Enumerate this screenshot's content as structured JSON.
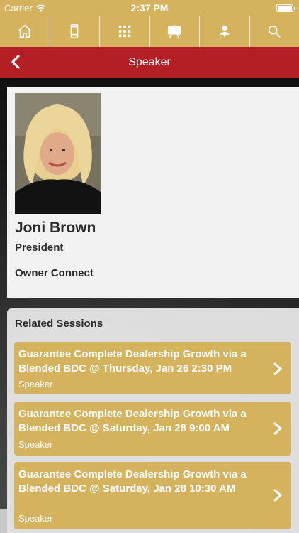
{
  "status_bar": {
    "carrier": "Carrier",
    "time": "2:37 PM"
  },
  "toolbar": {
    "items": [
      {
        "icon": "home-icon"
      },
      {
        "icon": "phone-icon"
      },
      {
        "icon": "grid-icon"
      },
      {
        "icon": "presentation-icon"
      },
      {
        "icon": "speaker-icon"
      },
      {
        "icon": "search-icon"
      }
    ]
  },
  "navbar": {
    "title": "Speaker"
  },
  "speaker": {
    "name": "Joni Brown",
    "title": "President",
    "company": "Owner Connect"
  },
  "related": {
    "heading": "Related Sessions",
    "sessions": [
      {
        "title": "Guarantee Complete Dealership Growth via a Blended BDC @ Thursday, Jan 26 2:30 PM",
        "role": "Speaker"
      },
      {
        "title": "Guarantee Complete Dealership Growth via a Blended BDC @ Saturday, Jan 28 9:00 AM",
        "role": "Speaker"
      },
      {
        "title": "Guarantee Complete Dealership Growth via a Blended BDC @ Saturday, Jan 28 10:30 AM",
        "role": "Speaker"
      }
    ]
  },
  "colors": {
    "gold": "#d4b25e",
    "red": "#b41f24"
  }
}
